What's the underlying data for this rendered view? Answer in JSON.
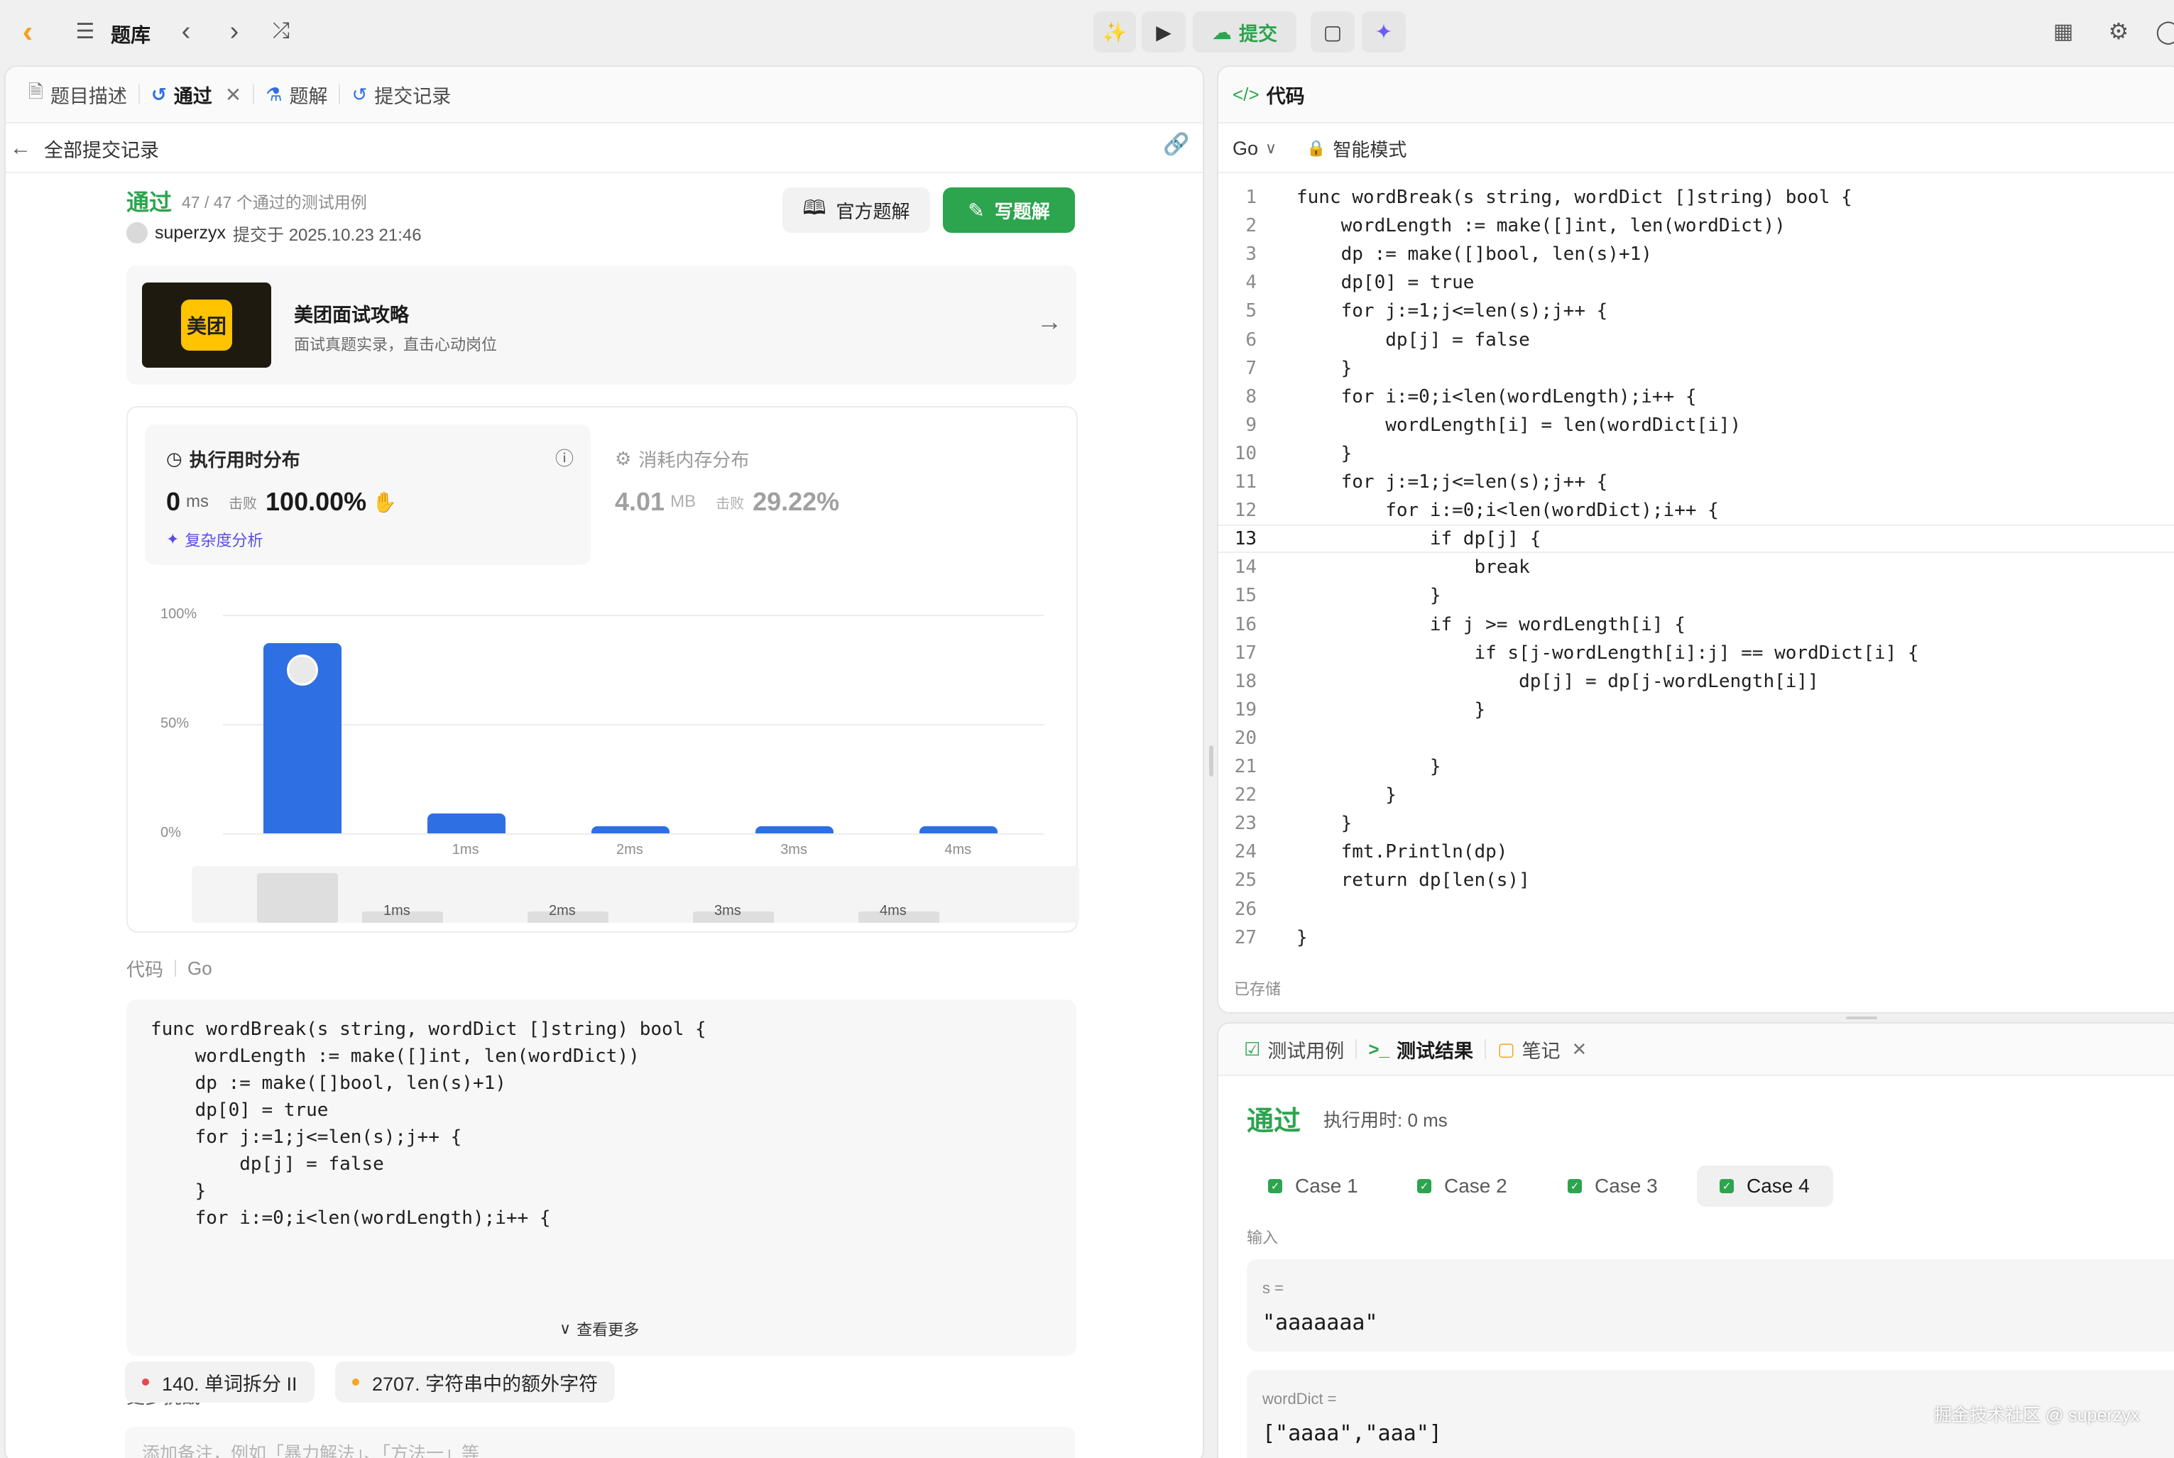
{
  "topbar": {
    "library_label": "题库",
    "submit_label": "提交"
  },
  "left_tabs": [
    {
      "label": "题目描述"
    },
    {
      "label": "通过"
    },
    {
      "label": "题解"
    },
    {
      "label": "提交记录"
    }
  ],
  "back": {
    "label": "全部提交记录"
  },
  "submission": {
    "status": "通过",
    "testcases": "47 / 47 个通过的测试用例",
    "user": "superzyx",
    "submitted_at": "提交于 2025.10.23 21:46",
    "official_solution_label": "官方题解",
    "write_solution_label": "写题解"
  },
  "ad": {
    "logo_text": "美团",
    "title": "美团面试攻略",
    "subtitle": "面试真题实录，直击心动岗位"
  },
  "stats": {
    "time_title": "执行用时分布",
    "time_value": "0",
    "time_unit": "ms",
    "beat_label": "击败",
    "time_beat": "100.00%",
    "complexity_label": "复杂度分析",
    "mem_title": "消耗内存分布",
    "mem_value": "4.01",
    "mem_unit": "MB",
    "mem_beat_label": "击败",
    "mem_beat": "29.22%"
  },
  "chart_data": {
    "type": "bar",
    "categories": [
      "",
      "1ms",
      "2ms",
      "3ms",
      "4ms"
    ],
    "values": [
      87,
      9,
      3,
      3,
      3
    ],
    "yticks": [
      "100%",
      "50%",
      "0%"
    ],
    "ylim": [
      0,
      100
    ],
    "grid": true,
    "minimap_labels": [
      "1ms",
      "2ms",
      "3ms",
      "4ms"
    ]
  },
  "code_section": {
    "label": "代码",
    "lang": "Go",
    "more_label": "查看更多",
    "lines": [
      "func wordBreak(s string, wordDict []string) bool {",
      "    wordLength := make([]int, len(wordDict))",
      "    dp := make([]bool, len(s)+1)",
      "    dp[0] = true",
      "    for j:=1;j<=len(s);j++ {",
      "        dp[j] = false",
      "    }",
      "    for i:=0;i<len(wordLength);i++ {"
    ]
  },
  "more_challenges": {
    "title": "更多挑战",
    "items": [
      {
        "label": "140. 单词拆分 II",
        "color": "#e5484d"
      },
      {
        "label": "2707. 字符串中的额外字符",
        "color": "#f5a623"
      }
    ]
  },
  "note_placeholder": "添加备注，例如「暴力解法」、「方法一」等",
  "editor": {
    "title": "代码",
    "lang": "Go",
    "mode": "智能模式",
    "saved": "已存储",
    "lines": [
      "func wordBreak(s string, wordDict []string) bool {",
      "    wordLength := make([]int, len(wordDict))",
      "    dp := make([]bool, len(s)+1)",
      "    dp[0] = true",
      "    for j:=1;j<=len(s);j++ {",
      "        dp[j] = false",
      "    }",
      "    for i:=0;i<len(wordLength);i++ {",
      "        wordLength[i] = len(wordDict[i])",
      "    }",
      "    for j:=1;j<=len(s);j++ {",
      "        for i:=0;i<len(wordDict);i++ {",
      "            if dp[j] {",
      "                break",
      "            }",
      "            if j >= wordLength[i] {",
      "                if s[j-wordLength[i]:j] == wordDict[i] {",
      "                    dp[j] = dp[j-wordLength[i]]",
      "                }",
      "            ",
      "            }",
      "        }",
      "    }",
      "    fmt.Println(dp)",
      "    return dp[len(s)]",
      "",
      "}"
    ]
  },
  "result_tabs": [
    {
      "label": "测试用例"
    },
    {
      "label": "测试结果"
    },
    {
      "label": "笔记"
    }
  ],
  "result": {
    "status": "通过",
    "runtime": "执行用时: 0 ms",
    "cases": [
      "Case 1",
      "Case 2",
      "Case 3",
      "Case 4"
    ],
    "input_label": "输入",
    "params": [
      {
        "name": "s =",
        "value": "\"aaaaaaa\""
      },
      {
        "name": "wordDict =",
        "value": "[\"aaaa\",\"aaa\"]"
      }
    ]
  },
  "watermark": "掘金技术社区 @ superzyx"
}
